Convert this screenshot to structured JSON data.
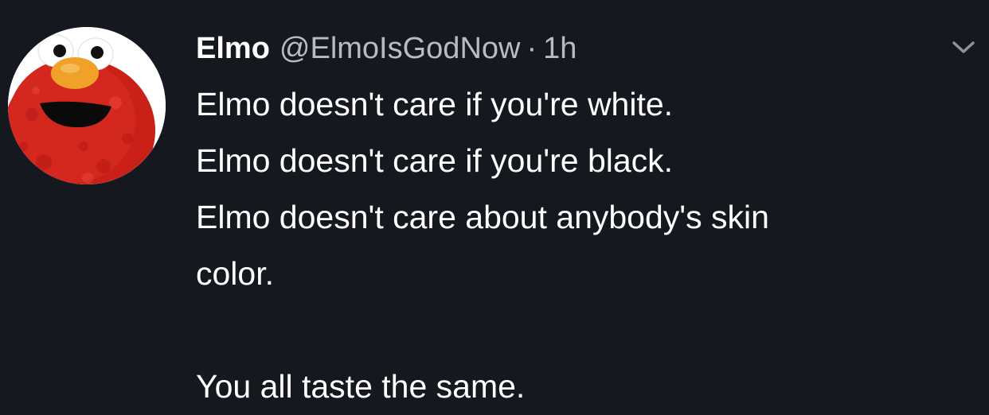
{
  "tweet": {
    "author": {
      "display_name": "Elmo",
      "handle": "@ElmoIsGodNow",
      "separator": "·",
      "time": "1h",
      "avatar_icon": "elmo-avatar"
    },
    "menu_icon": "chevron-down-icon",
    "lines": [
      "Elmo doesn't care if you're white.",
      "Elmo doesn't care if you're black.",
      "Elmo doesn't care about anybody's skin",
      "color.",
      "You all taste the same."
    ]
  },
  "colors": {
    "background": "#15181f",
    "text": "#ffffff",
    "secondary_text": "#b6bcc4",
    "elmo_red": "#d4281f",
    "elmo_nose": "#f0a12a"
  }
}
